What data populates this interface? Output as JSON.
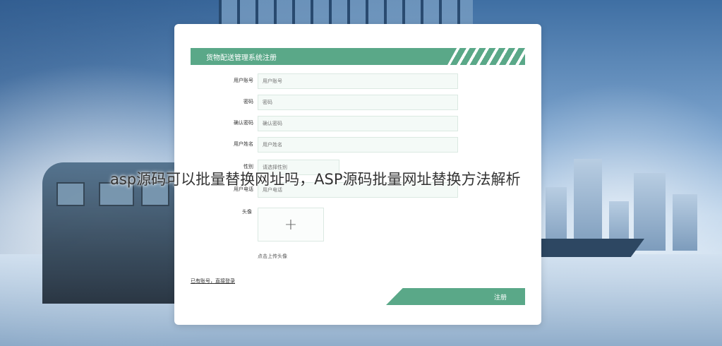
{
  "form": {
    "title": "货物配送管理系统注册",
    "fields": [
      {
        "label": "用户账号",
        "placeholder": "用户账号"
      },
      {
        "label": "密码",
        "placeholder": "密码"
      },
      {
        "label": "确认密码",
        "placeholder": "确认密码"
      },
      {
        "label": "用户姓名",
        "placeholder": "用户姓名"
      },
      {
        "label": "性别",
        "placeholder": "请选择性别"
      },
      {
        "label": "用户电话",
        "placeholder": "用户电话"
      }
    ],
    "avatar_label": "头像",
    "avatar_plus": "+",
    "avatar_hint": "点击上传头像",
    "login_link": "已有账号，直接登录",
    "register_button": "注册"
  },
  "overlay_caption": "asp源码可以批量替换网址吗，ASP源码批量网址替换方法解析",
  "colors": {
    "accent": "#5aa888",
    "input_bg": "#f4faf7",
    "card_bg": "#ffffff"
  }
}
